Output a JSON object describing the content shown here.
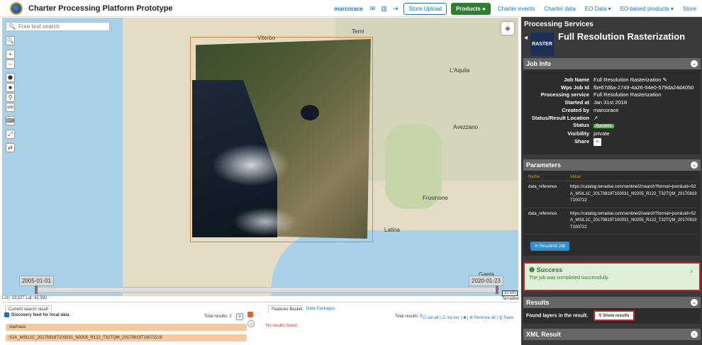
{
  "header": {
    "title": "Charter Processing Platform Prototype",
    "username": "marcorace",
    "store_upload": "Store Upload",
    "products": "Products",
    "nav": [
      "Charter events",
      "Charter data",
      "EO Data ▾",
      "EO-based products ▾",
      "Store"
    ]
  },
  "map": {
    "search_placeholder": "Free text search",
    "place_names": [
      "Terni",
      "Viterbo",
      "L'Aquila",
      "Avezzano",
      "Frosinone",
      "Latina",
      "Gaeta"
    ],
    "time_start": "2005-01-01",
    "time_end": "2020-01-23",
    "scale": "10 km",
    "coords": "Lon: 13.527 Lat: 42.592",
    "attribution": "Terradue"
  },
  "bottom": {
    "tab_current": "Current search result",
    "tab_features": "Features Basket",
    "tab_packages": "Data Packages",
    "feed_label": "Discovery feed for local data",
    "total_left": "Total results: 2",
    "item1": "startrace",
    "item2": "S2A_MSIL1C_20170819T100031_N0205_R122_T32TQM_20170819T100722.tif",
    "total_right": "Total results: 0",
    "select_bar": "☑ sel.all | ☑ inv.sel. | ■ | ⊗ Remove all | 🖫 Save",
    "no_results": "No results found."
  },
  "panel": {
    "section_title": "Processing Services",
    "service_icon": "RASTER",
    "service_name": "Full Resolution Rasterization",
    "job_info_title": "Job Info",
    "job_rows": [
      {
        "label": "Job Name",
        "value": "Full Resolution Rasterization ✎"
      },
      {
        "label": "Wps Job Id",
        "value": "fbe67d6a-2749-4a26-94e0-579da24d4050"
      },
      {
        "label": "Processing service",
        "value": "Full Resolution Rasterization"
      },
      {
        "label": "Started at",
        "value": "Jan 31st 2018"
      },
      {
        "label": "Created by",
        "value": "marcorace"
      },
      {
        "label": "Status/Result Location",
        "value": "↗"
      },
      {
        "label": "Status",
        "value": "Success"
      },
      {
        "label": "Visibility",
        "value": "private"
      },
      {
        "label": "Share",
        "value": "<"
      }
    ],
    "params_title": "Parameters",
    "params_col_name": "Name",
    "params_col_value": "Value",
    "params": [
      {
        "name": "data_reference",
        "value": "https://catalog.terradue.com/sentinel2/search?format=json&uid=S2A_MSIL1C_20170819T100031_N0205_R122_T32TQM_20170819T100722"
      },
      {
        "name": "data_reference",
        "value": "https://catalog.terradue.com/sentinel2/search?format=json&uid=S2A_MSIL1C_20170819T100031_N0205_R122_T32TQM_20170819T100722"
      }
    ],
    "resubmit": "Resubmit Job",
    "success_title": "Success",
    "success_msg": "The job was completed successfully.",
    "results_title": "Results",
    "results_text": "Found layers in the result.",
    "show_results": "Show results",
    "xml_title": "XML Result"
  }
}
